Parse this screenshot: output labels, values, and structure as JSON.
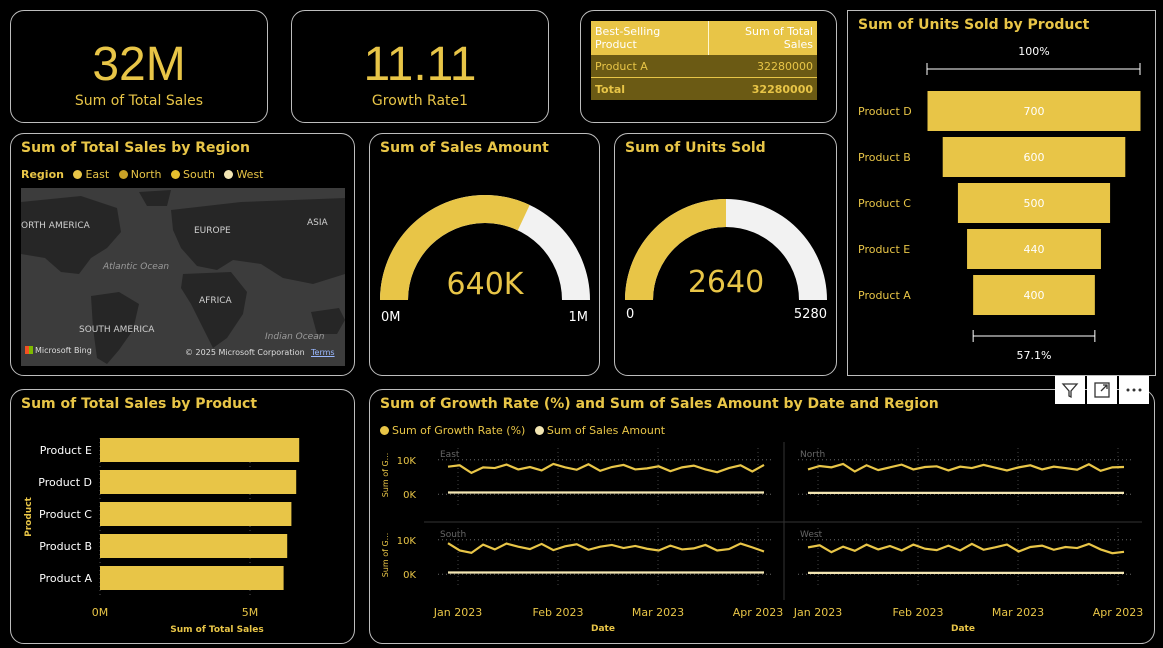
{
  "kpi_total_sales": {
    "value": "32M",
    "label": "Sum of Total Sales"
  },
  "kpi_growth": {
    "value": "11.11",
    "label": "Growth Rate1"
  },
  "best_table": {
    "headers": [
      "Best-Selling Product",
      "Sum of Total Sales"
    ],
    "row": [
      "Product A",
      "32280000"
    ],
    "total": [
      "Total",
      "32280000"
    ]
  },
  "map_card": {
    "title": "Sum of Total Sales by Region",
    "legend_title": "Region",
    "legend": [
      {
        "name": "East",
        "color": "#e8c547"
      },
      {
        "name": "North",
        "color": "#c9a227"
      },
      {
        "name": "South",
        "color": "#e6c02e"
      },
      {
        "name": "West",
        "color": "#f3e6b3"
      }
    ],
    "labels": {
      "north_america": "ORTH AMERICA",
      "europe": "EUROPE",
      "asia": "ASIA",
      "atlantic": "Atlantic Ocean",
      "africa": "AFRICA",
      "south_america": "SOUTH AMERICA",
      "indian": "Indian Ocean"
    },
    "bing": "Microsoft Bing",
    "copyright": "© 2025 Microsoft Corporation",
    "terms": "Terms"
  },
  "gauge_sales": {
    "title": "Sum of Sales Amount",
    "value_label": "640K",
    "min_label": "0M",
    "max_label": "1M"
  },
  "gauge_units": {
    "title": "Sum of Units Sold",
    "value_label": "2640",
    "min_label": "0",
    "max_label": "5280"
  },
  "funnel_card": {
    "title": "Sum of Units Sold by Product",
    "top_pct": "100%",
    "bottom_pct": "57.1%"
  },
  "bar_card": {
    "title": "Sum of Total Sales by Product"
  },
  "line_card": {
    "title": "Sum of Growth Rate (%) and Sum of Sales Amount by Date and Region",
    "legend": [
      {
        "name": "Sum of Growth Rate (%)",
        "color": "#e8c547"
      },
      {
        "name": "Sum of Sales Amount",
        "color": "#f3e6b3"
      }
    ],
    "ylabel_short": "Sum of G..."
  },
  "chart_data": [
    {
      "type": "funnel",
      "title": "Sum of Units Sold by Product",
      "categories": [
        "Product D",
        "Product B",
        "Product C",
        "Product E",
        "Product A"
      ],
      "values": [
        700,
        600,
        500,
        440,
        400
      ],
      "value_labels": [
        "700",
        "600",
        "500",
        "440",
        "400"
      ],
      "color": "#e8c547"
    },
    {
      "type": "bar",
      "orientation": "horizontal",
      "title": "Sum of Total Sales by Product",
      "categories": [
        "Product E",
        "Product D",
        "Product C",
        "Product B",
        "Product A"
      ],
      "values": [
        6640000,
        6540000,
        6380000,
        6240000,
        6120000
      ],
      "xlabel": "Sum of Total Sales",
      "ylabel": "Product",
      "xlim": [
        0,
        10000000
      ],
      "xticks": [
        0,
        5000000
      ],
      "xtick_labels": [
        "0M",
        "5M"
      ],
      "color": "#e8c547"
    },
    {
      "type": "gauge",
      "title": "Sum of Sales Amount",
      "value": 640000,
      "min": 0,
      "max": 1000000,
      "fill": "#e8c547",
      "track": "#f2f2f2"
    },
    {
      "type": "gauge",
      "title": "Sum of Units Sold",
      "value": 2640,
      "min": 0,
      "max": 5280,
      "fill": "#e8c547",
      "track": "#f2f2f2"
    },
    {
      "type": "line",
      "title": "Sum of Growth Rate (%) and Sum of Sales Amount by Date and Region",
      "xlabel": "Date",
      "ylabel": "Sum of G...",
      "ylim": [
        -4000,
        14000
      ],
      "yticks": [
        0,
        10000
      ],
      "ytick_labels": [
        "0K",
        "10K"
      ],
      "xticks": [
        "Jan 2023",
        "Feb 2023",
        "Mar 2023",
        "Apr 2023"
      ],
      "panels": [
        {
          "name": "East",
          "growth": [
            8000,
            8400,
            6200,
            7800,
            7600,
            8600,
            7200,
            7900,
            6900,
            8800,
            7800,
            7100,
            8700,
            6800,
            7900,
            8500,
            7200,
            7500,
            8100,
            6700,
            7800,
            8300,
            7200,
            6400,
            7600,
            8400,
            6600,
            8500
          ],
          "sales": [
            500,
            500,
            500,
            500,
            500,
            500,
            500,
            500,
            500,
            500,
            500,
            500,
            500,
            500,
            500,
            500,
            500,
            500,
            500,
            500,
            500,
            500,
            500,
            500,
            500,
            500,
            500,
            500
          ]
        },
        {
          "name": "North",
          "growth": [
            7200,
            8200,
            7800,
            8800,
            6600,
            8400,
            7000,
            7800,
            8600,
            7200,
            7900,
            8100,
            6900,
            8000,
            7600,
            8500,
            7700,
            6900,
            7800,
            8400,
            7200,
            8000,
            7600,
            7100,
            8700,
            6800,
            7800,
            7900
          ],
          "sales": [
            400,
            400,
            400,
            400,
            400,
            400,
            400,
            400,
            400,
            400,
            400,
            400,
            400,
            400,
            400,
            400,
            400,
            400,
            400,
            400,
            400,
            400,
            400,
            400,
            400,
            400,
            400,
            400
          ]
        },
        {
          "name": "South",
          "growth": [
            9000,
            6900,
            6200,
            8600,
            7200,
            8900,
            8000,
            7300,
            8800,
            7000,
            8100,
            8700,
            7100,
            8000,
            8500,
            7600,
            8200,
            7400,
            6900,
            8300,
            7200,
            7500,
            8500,
            6900,
            7300,
            8900,
            7800,
            6600
          ],
          "sales": [
            500,
            500,
            500,
            500,
            500,
            500,
            500,
            500,
            500,
            500,
            500,
            500,
            500,
            500,
            500,
            500,
            500,
            500,
            500,
            500,
            500,
            500,
            500,
            500,
            500,
            500,
            500,
            500
          ]
        },
        {
          "name": "West",
          "growth": [
            7800,
            8400,
            6400,
            8000,
            6800,
            8600,
            7200,
            8200,
            6900,
            8600,
            7400,
            7000,
            8300,
            6900,
            8800,
            7100,
            7800,
            8600,
            6600,
            7900,
            8300,
            7100,
            7900,
            7600,
            8800,
            7200,
            6100,
            6500
          ],
          "sales": [
            400,
            400,
            400,
            400,
            400,
            400,
            400,
            400,
            400,
            400,
            400,
            400,
            400,
            400,
            400,
            400,
            400,
            400,
            400,
            400,
            400,
            400,
            400,
            400,
            400,
            400,
            400,
            400
          ]
        }
      ],
      "series": [
        {
          "name": "Sum of Growth Rate (%)",
          "color": "#e8c547"
        },
        {
          "name": "Sum of Sales Amount",
          "color": "#f3e6b3"
        }
      ]
    }
  ]
}
